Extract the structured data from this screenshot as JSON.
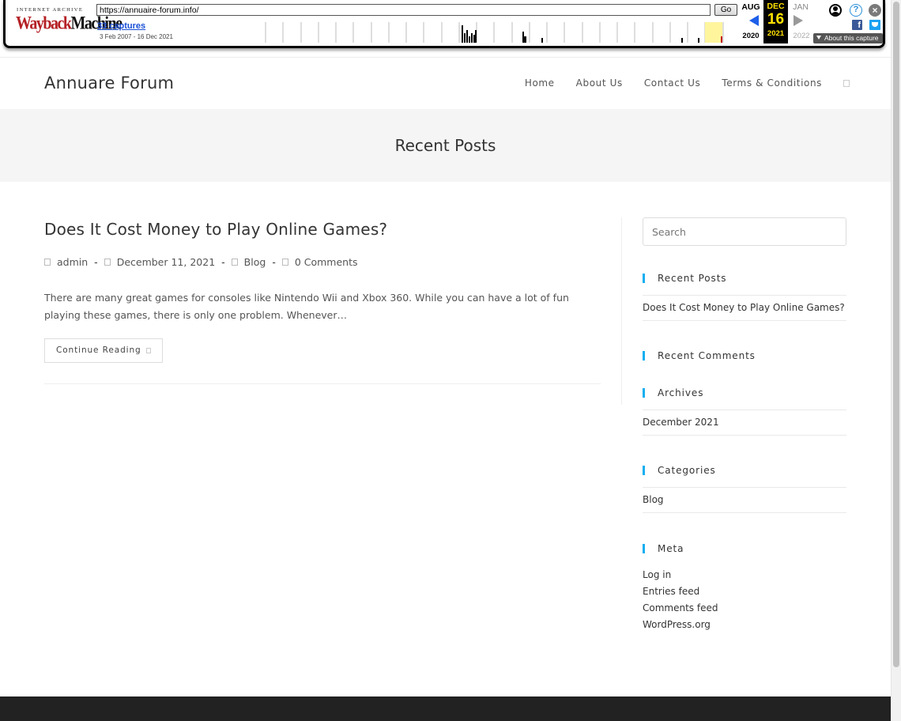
{
  "wayback": {
    "archive_label": "INTERNET ARCHIVE",
    "logo_red": "Wayback",
    "logo_dark": "Machine",
    "url": "https://annuaire-forum.info/",
    "go_label": "Go",
    "captures_link": "33 captures",
    "date_range": "3 Feb 2007 - 16 Dec 2021",
    "prev_month": "AUG",
    "current_month": "DEC",
    "current_day": "16",
    "next_month": "JAN",
    "prev_year": "2020",
    "current_year": "2021",
    "next_year": "2022",
    "about_label": "About this capture",
    "help_glyph": "?",
    "close_glyph": "×",
    "fb_glyph": "f"
  },
  "site": {
    "logo": "Annuare Forum",
    "nav": [
      "Home",
      "About Us",
      "Contact Us",
      "Terms & Conditions"
    ]
  },
  "page_title": "Recent Posts",
  "post": {
    "title": "Does It Cost Money to Play Online Games?",
    "author": "admin",
    "date": "December 11, 2021",
    "category": "Blog",
    "comments": "0 Comments",
    "separator": "-",
    "excerpt": "There are many great games for consoles like Nintendo Wii and Xbox 360. While you can have a lot of fun playing these games, there is only one problem. Whenever…",
    "read_more": "Continue Reading"
  },
  "sidebar": {
    "search_placeholder": "Search",
    "recent_posts_title": "Recent Posts",
    "recent_posts": [
      "Does It Cost Money to Play Online Games?"
    ],
    "recent_comments_title": "Recent Comments",
    "archives_title": "Archives",
    "archives": [
      "December 2021"
    ],
    "categories_title": "Categories",
    "categories": [
      "Blog"
    ],
    "meta_title": "Meta",
    "meta_links": [
      "Log in",
      "Entries feed",
      "Comments feed",
      "WordPress.org"
    ]
  },
  "colors": {
    "accent": "#13aff0",
    "wayback_red": "#b42025",
    "wayback_yellow": "#ffe100",
    "footer": "#222222"
  }
}
